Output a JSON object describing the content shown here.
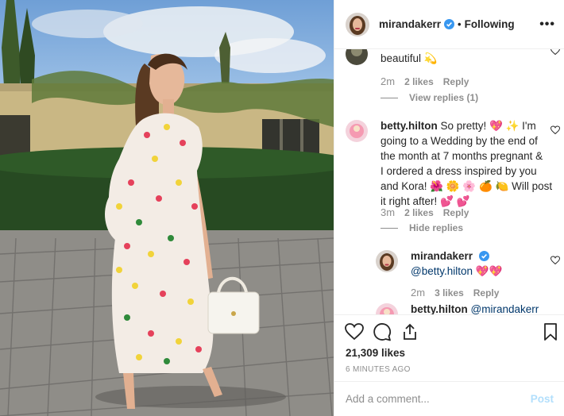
{
  "header": {
    "username": "mirandakerr",
    "separator": "•",
    "follow_label": "Following",
    "more_label": "•••",
    "verified_icon": "verified-badge-icon",
    "avatar_color": "#b23a48"
  },
  "comments": [
    {
      "text": "beautiful 💫",
      "time": "2m",
      "likes": "2 likes",
      "reply": "Reply",
      "view_replies": "View replies (1)"
    },
    {
      "username": "betty.hilton",
      "text": "So pretty! 💖✨ I'm going to a Wedding by the end of the month at 7 months pregnant & I ordered a dress inspired by you and Kora! 🌺🌼🌸🍊🍋 Will post it right after! 💕💕",
      "lines": [
        "So pretty! 💖 ✨ I'm",
        "going to a Wedding by the end of",
        "the month at 7 months pregnant &",
        "I ordered a dress inspired by you",
        "and Kora! 🌺 🌼 🌸 🍊 🍋 Will post",
        "it right after! 💕 💕"
      ],
      "time": "3m",
      "likes": "2 likes",
      "reply": "Reply",
      "hide_replies": "Hide replies"
    },
    {
      "username": "mirandakerr",
      "text_mention": "@betty.hilton",
      "text_emoji": "💖💖",
      "time": "2m",
      "likes": "3 likes",
      "reply": "Reply"
    },
    {
      "username": "betty.hilton",
      "text_mention": "@mirandakerr"
    }
  ],
  "actions": {
    "likes": "21,309 likes",
    "time_ago": "6 MINUTES AGO"
  },
  "add_comment": {
    "placeholder": "Add a comment...",
    "post_label": "Post",
    "post_color": "#b2dffc"
  }
}
